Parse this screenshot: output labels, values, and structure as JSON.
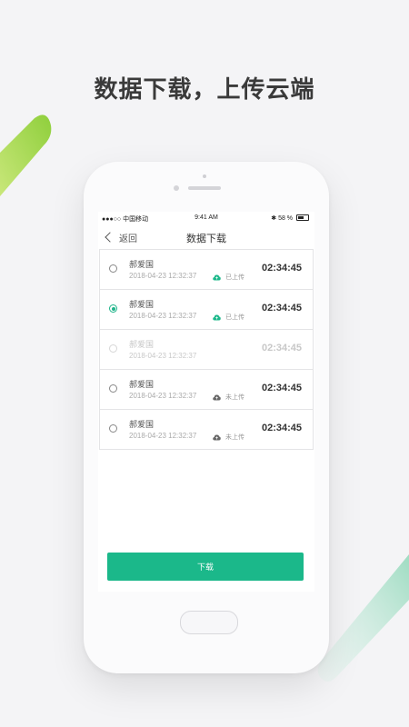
{
  "headline": "数据下载，上传云端",
  "colors": {
    "accent": "#1bb88a",
    "deco_green": "#9fd34a",
    "deco_teal": "#8fd9c4"
  },
  "status_bar": {
    "carrier": "●●●○○ 中国移动",
    "time": "9:41 AM",
    "battery": "58 %"
  },
  "nav": {
    "back_label": "返回",
    "title": "数据下载"
  },
  "records": [
    {
      "name": "郝爱国",
      "datetime": "2018-04-23 12:32:37",
      "status": "已上传",
      "status_icon": "cloud-uploaded-icon",
      "duration": "02:34:45",
      "selected": false,
      "disabled": false
    },
    {
      "name": "郝爱国",
      "datetime": "2018-04-23 12:32:37",
      "status": "已上传",
      "status_icon": "cloud-uploaded-icon",
      "duration": "02:34:45",
      "selected": true,
      "disabled": false
    },
    {
      "name": "郝爱国",
      "datetime": "2018-04-23 12:32:37",
      "status": "",
      "status_icon": "",
      "duration": "02:34:45",
      "selected": false,
      "disabled": true
    },
    {
      "name": "郝爱国",
      "datetime": "2018-04-23 12:32:37",
      "status": "未上传",
      "status_icon": "cloud-not-uploaded-icon",
      "duration": "02:34:45",
      "selected": false,
      "disabled": false
    },
    {
      "name": "郝爱国",
      "datetime": "2018-04-23 12:32:37",
      "status": "未上传",
      "status_icon": "cloud-not-uploaded-icon",
      "duration": "02:34:45",
      "selected": false,
      "disabled": false
    }
  ],
  "download_button": "下载"
}
